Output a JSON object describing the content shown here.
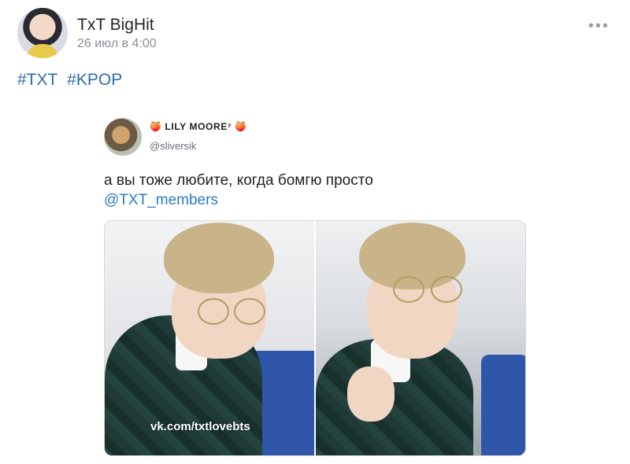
{
  "post": {
    "author": "TxT BigHit",
    "date": "26 июл в 4:00",
    "more_icon": "more-horizontal-icon",
    "hashtags": [
      "#TXT",
      "#KPOP"
    ]
  },
  "tweet": {
    "display_name": "🍑 LILY MOORE⁷ 🍑",
    "handle": "@sliversik",
    "text": "а вы тоже любите, когда бомгю просто",
    "mention": "@TXT_members",
    "watermark": "vk.com/txtlovebts"
  },
  "colors": {
    "link": "#2e6db3",
    "mention": "#2b7bc4",
    "muted": "#8a8f96"
  }
}
